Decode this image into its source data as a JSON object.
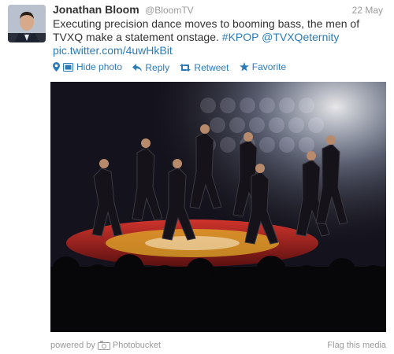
{
  "tweet": {
    "name": "Jonathan Bloom",
    "handle": "@BloomTV",
    "date": "22 May",
    "text_main": "Executing precision dance moves to booming bass, the men of TVXQ make a statement onstage. ",
    "hashtag": "#KPOP",
    "mention": "@TVXQeternity",
    "pic_link": "pic.twitter.com/4uwHkBit"
  },
  "actions": {
    "hide_photo": "Hide photo",
    "reply": "Reply",
    "retweet": "Retweet",
    "favorite": "Favorite"
  },
  "media": {
    "powered_by": "powered by",
    "provider": "Photobucket",
    "flag": "Flag this media"
  },
  "icons": [
    "location-pin-icon",
    "photo-icon",
    "reply-arrow-icon",
    "retweet-icon",
    "star-icon",
    "camera-icon"
  ],
  "colors": {
    "link": "#2b7bb9",
    "muted": "#999999",
    "text": "#333333"
  }
}
